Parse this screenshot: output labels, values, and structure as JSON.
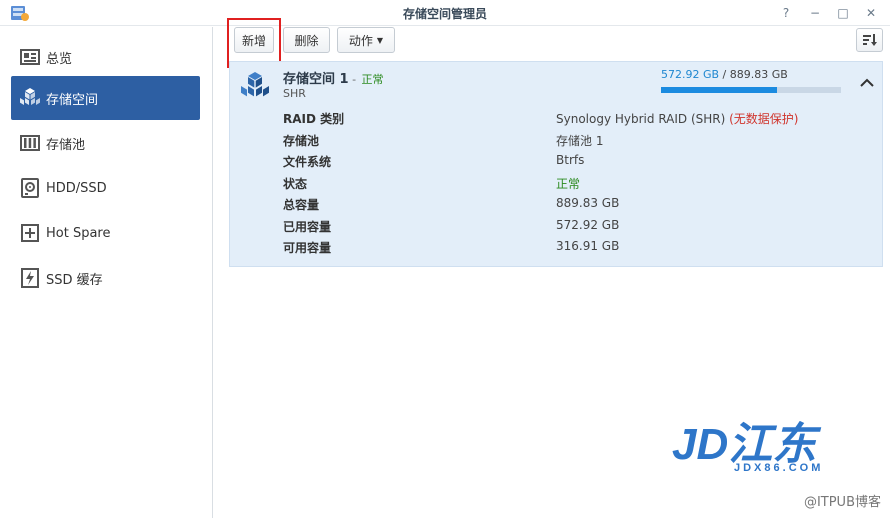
{
  "window": {
    "title": "存储空间管理员",
    "controls": [
      "?",
      "−",
      "□",
      "✕"
    ]
  },
  "sidebar": {
    "items": [
      {
        "label": "总览",
        "icon": "overview-icon",
        "active": false
      },
      {
        "label": "存储空间",
        "icon": "volume-cubes-icon",
        "active": true
      },
      {
        "label": "存储池",
        "icon": "storage-pool-icon",
        "active": false
      },
      {
        "label": "HDD/SSD",
        "icon": "hdd-icon",
        "active": false
      },
      {
        "label": "Hot Spare",
        "icon": "hot-spare-plus-icon",
        "active": false
      },
      {
        "label": "SSD 缓存",
        "icon": "ssd-cache-icon",
        "active": false
      }
    ]
  },
  "toolbar": {
    "create_label": "新增",
    "delete_label": "删除",
    "action_label": "动作",
    "sort_icon": "sort-icon"
  },
  "volume": {
    "name": "存储空间 1",
    "dash": " - ",
    "status": "正常",
    "type": "SHR",
    "used": "572.92 GB",
    "separator": " / ",
    "total": "889.83 GB",
    "usage_fraction": 0.644,
    "details": [
      {
        "key": "RAID 类别",
        "value": "Synology Hybrid RAID (SHR)",
        "warning": " (无数据保护)"
      },
      {
        "key": "存储池",
        "value": "存储池 1"
      },
      {
        "key": "文件系统",
        "value": "Btrfs"
      },
      {
        "key": "状态",
        "value": "正常",
        "ok": true
      },
      {
        "key": "总容量",
        "value": "889.83 GB"
      },
      {
        "key": "已用容量",
        "value": "572.92 GB"
      },
      {
        "key": "可用容量",
        "value": "316.91 GB"
      }
    ]
  },
  "watermark": {
    "logo_text": "JD江东",
    "logo_sub": "JDX86.COM",
    "credit": "@ITPUB博客"
  },
  "colors": {
    "accent": "#2d5fa3",
    "panel_bg": "#e3eef9",
    "usage_fill": "#1c8be0",
    "ok": "#2b8a1f",
    "warning": "#d0342c",
    "highlight": "#e02020"
  }
}
